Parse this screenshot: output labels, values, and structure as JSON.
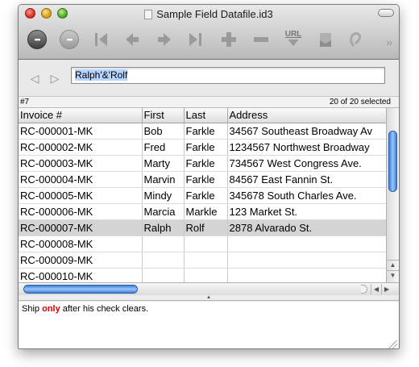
{
  "window": {
    "title": "Sample Field Datafile.id3"
  },
  "toolbar": {
    "icons": [
      "actions-icon",
      "more-actions-icon",
      "first-record-icon",
      "previous-record-icon",
      "next-record-icon",
      "last-record-icon",
      "add-record-icon",
      "delete-record-icon",
      "url-icon",
      "mail-icon",
      "attach-icon",
      "overflow-chevron-icon"
    ],
    "url_label": "URL",
    "overflow": "»"
  },
  "search": {
    "value_prefix": "",
    "value_selected": "Ralph'&'Rolf",
    "back": "◁",
    "forward": "▷"
  },
  "status": {
    "record": "#7",
    "selected": "20 of 20 selected"
  },
  "table": {
    "columns": [
      "Invoice #",
      "First",
      "Last",
      "Address"
    ],
    "rows": [
      [
        "RC-000001-MK",
        "Bob",
        "Farkle",
        "34567 Southeast Broadway Av"
      ],
      [
        "RC-000002-MK",
        "Fred",
        "Farkle",
        "1234567 Northwest Broadway"
      ],
      [
        "RC-000003-MK",
        "Marty",
        "Farkle",
        "734567 West Congress Ave."
      ],
      [
        "RC-000004-MK",
        "Marvin",
        "Farkle",
        "84567 East Fannin St."
      ],
      [
        "RC-000005-MK",
        "Mindy",
        "Farkle",
        "345678 South Charles Ave."
      ],
      [
        "RC-000006-MK",
        "Marcia",
        "Markle",
        "123 Market St."
      ],
      [
        "RC-000007-MK",
        "Ralph",
        "Rolf",
        "2878 Alvarado St."
      ],
      [
        "RC-000008-MK",
        "",
        "",
        ""
      ],
      [
        "RC-000009-MK",
        "",
        "",
        ""
      ],
      [
        "RC-000010-MK",
        "",
        "",
        ""
      ]
    ],
    "selected_row": 6
  },
  "notes": {
    "before": "Ship ",
    "highlight": "only",
    "after": " after his check clears."
  },
  "colors": {
    "highlight_text": "#e00000",
    "selection_bg": "#b5d5ff",
    "selected_row_bg": "#d4d4d4",
    "scroll_thumb": "#3d7fd8"
  }
}
